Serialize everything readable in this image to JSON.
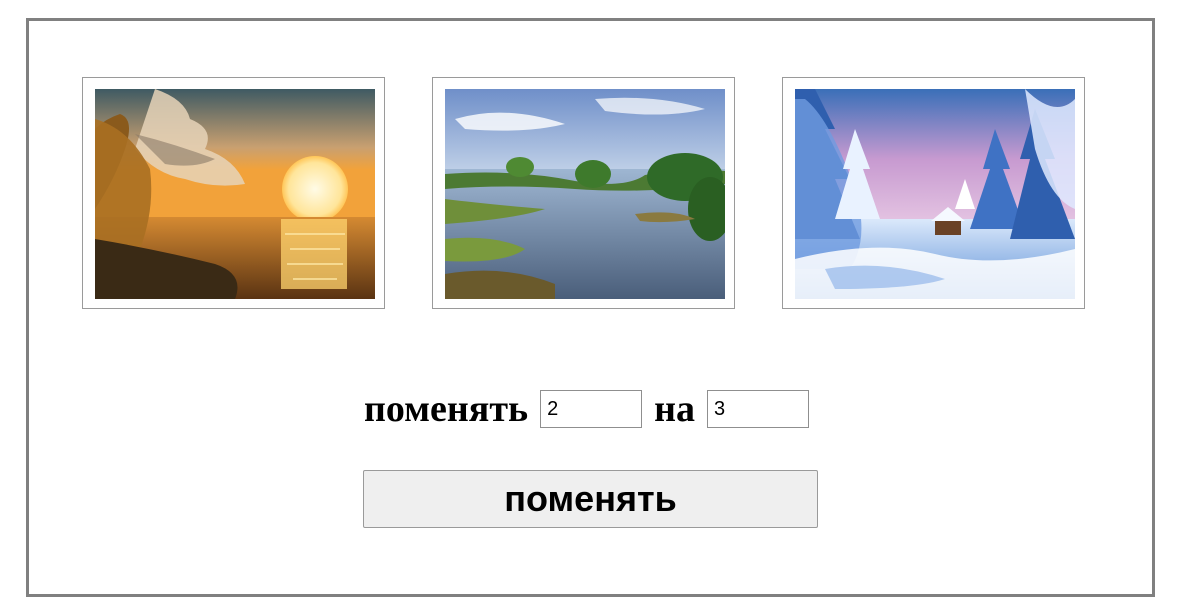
{
  "gallery": {
    "images": [
      {
        "index": 1,
        "subject": "sunset over sea"
      },
      {
        "index": 2,
        "subject": "river landscape in summer"
      },
      {
        "index": 3,
        "subject": "snowy winter forest"
      }
    ]
  },
  "swap": {
    "label_swap": "поменять",
    "field_from_value": "2",
    "label_to": "на",
    "field_to_value": "3",
    "button_label": "поменять"
  }
}
